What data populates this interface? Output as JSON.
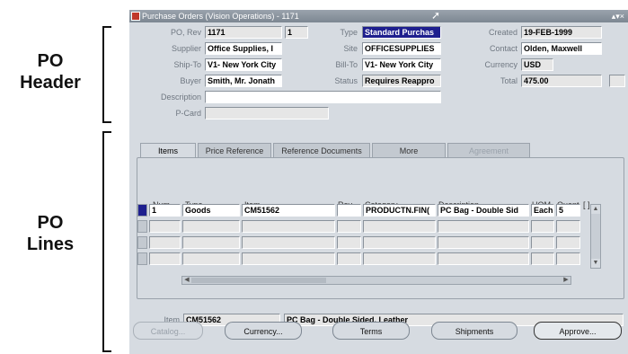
{
  "annotations": {
    "header_label": "PO\nHeader",
    "lines_label": "PO\nLines"
  },
  "window": {
    "title": "Purchase Orders (Vision Operations) - 1171"
  },
  "header": {
    "po_rev_label": "PO, Rev",
    "po_number": "1171",
    "revision": "1",
    "type_label": "Type",
    "type_value": "Standard Purchas",
    "created_label": "Created",
    "created_value": "19-FEB-1999",
    "supplier_label": "Supplier",
    "supplier_value": "Office Supplies, I",
    "site_label": "Site",
    "site_value": "OFFICESUPPLIES",
    "contact_label": "Contact",
    "contact_value": "Olden, Maxwell",
    "ship_to_label": "Ship-To",
    "ship_to_value": "V1- New York City",
    "bill_to_label": "Bill-To",
    "bill_to_value": "V1- New York City",
    "currency_label": "Currency",
    "currency_value": "USD",
    "buyer_label": "Buyer",
    "buyer_value": "Smith, Mr. Jonath",
    "status_label": "Status",
    "status_value": "Requires Reappro",
    "total_label": "Total",
    "total_value": "475.00",
    "description_label": "Description",
    "description_value": "",
    "pcard_label": "P-Card",
    "pcard_value": ""
  },
  "tabs": [
    {
      "label": "Items",
      "active": true
    },
    {
      "label": "Price Reference"
    },
    {
      "label": "Reference Documents"
    },
    {
      "label": "More"
    },
    {
      "label": "Agreement",
      "disabled": true
    }
  ],
  "lines": {
    "columns": [
      "Num",
      "Type",
      "Item",
      "Rev",
      "Category",
      "Description",
      "UOM",
      "Quant",
      "[ ]"
    ],
    "rows": [
      {
        "num": "1",
        "type": "Goods",
        "item": "CM51562",
        "rev": "",
        "category": "PRODUCTN.FIN(",
        "description": "PC Bag - Double Sid",
        "uom": "Each",
        "quantity": "5"
      }
    ]
  },
  "footer": {
    "item_label": "Item",
    "item_value": "CM51562",
    "item_description": "PC Bag - Double Sided, Leather"
  },
  "buttons": {
    "catalog": "Catalog...",
    "currency": "Currency...",
    "terms": "Terms",
    "shipments": "Shipments",
    "approve": "Approve..."
  }
}
